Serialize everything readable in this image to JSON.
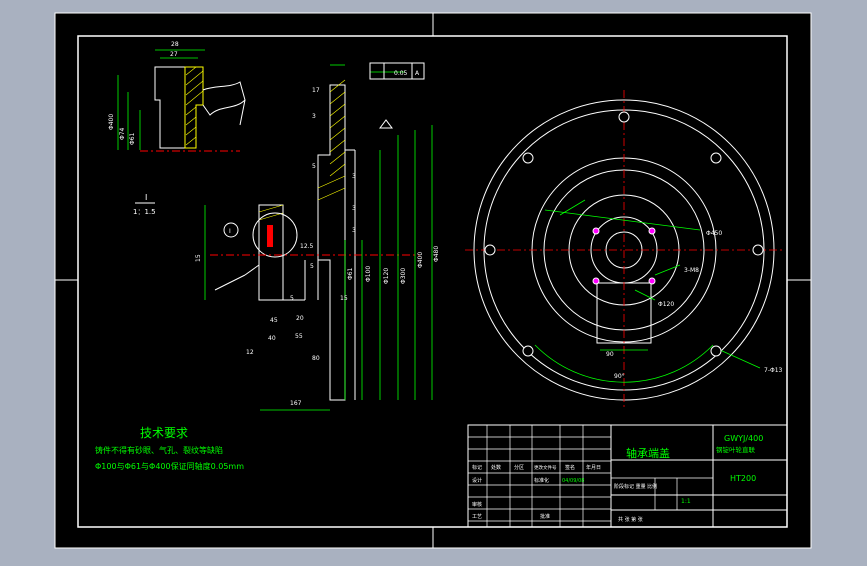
{
  "drawing": {
    "scheme": {
      "background": "#000000",
      "frame": "#ffffff",
      "geometry": "#ffffff",
      "dimensions": "#00ff00",
      "centerline": "#ff0000",
      "hatch": "#ffff00",
      "note": "#00ff00"
    },
    "title_block": {
      "part_name": "轴承端盖",
      "product": "GWYJ/400",
      "product_sub": "钢锭叶轮直联",
      "material": "HT200",
      "scale": "1:1",
      "sheet": "共 张 第 张",
      "date": "04/09/08",
      "rows": [
        "标记",
        "处数",
        "分区",
        "更改文件号",
        "签名",
        "年月日"
      ],
      "roles": [
        "设计",
        "审核",
        "工艺",
        "标准化",
        "批准"
      ],
      "stage_labels": "阶段标记 重量 比例"
    },
    "notes": {
      "heading": "技术要求",
      "lines": [
        "铸件不得有砂眼、气孔、裂纹等缺陷",
        "Φ100与Φ61与Φ400保证同轴度0.05mm"
      ]
    },
    "detail_view": {
      "label": "I",
      "scale": "1：1.5",
      "dims": [
        "28",
        "27",
        "Φ400",
        "Φ61",
        "Φ74"
      ]
    },
    "section_view": {
      "tolerance": [
        "0.05",
        "A"
      ],
      "dims": [
        "17",
        "3",
        "5",
        "3",
        "3",
        "3",
        "5",
        "12.5",
        "Φ61",
        "Φ100",
        "Φ120",
        "Φ300",
        "Φ400",
        "Φ480",
        "15",
        "5",
        "20",
        "45",
        "40",
        "55",
        "80",
        "12",
        "15",
        "167"
      ],
      "datum": "A",
      "detail_ref": "I"
    },
    "front_view": {
      "dims": [
        "Φ450",
        "3-M8",
        "Φ120",
        "90",
        "90°",
        "7-Φ13"
      ]
    }
  }
}
